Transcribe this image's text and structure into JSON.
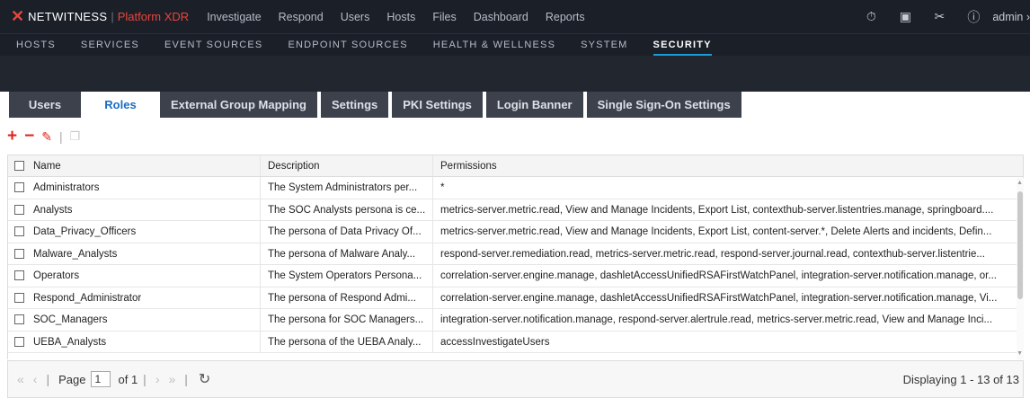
{
  "app": {
    "brand": "NETWITNESS",
    "product": "Platform XDR",
    "colors": {
      "brand_red": "#e8453c",
      "accent_blue": "#1b9bd7",
      "active_tab_text": "#1b6dc1"
    }
  },
  "topnav": {
    "items": [
      "Investigate",
      "Respond",
      "Users",
      "Hosts",
      "Files",
      "Dashboard",
      "Reports"
    ],
    "icons": [
      "timer-icon",
      "notepad-icon",
      "tools-icon",
      "help-icon"
    ],
    "user": "admin"
  },
  "subnav": {
    "items": [
      "HOSTS",
      "SERVICES",
      "EVENT SOURCES",
      "ENDPOINT SOURCES",
      "HEALTH & WELLNESS",
      "SYSTEM",
      "SECURITY"
    ],
    "active": "SECURITY"
  },
  "tabs": {
    "items": [
      "Users",
      "Roles",
      "External Group Mapping",
      "Settings",
      "PKI Settings",
      "Login Banner",
      "Single Sign-On Settings"
    ],
    "active": "Roles"
  },
  "toolbar": {
    "icons": [
      "add-icon",
      "remove-icon",
      "edit-icon",
      "copy-icon"
    ]
  },
  "grid": {
    "columns": [
      "Name",
      "Description",
      "Permissions"
    ],
    "rows": [
      {
        "name": "Administrators",
        "description": "The System Administrators per...",
        "permissions": "*"
      },
      {
        "name": "Analysts",
        "description": "The SOC Analysts persona is ce...",
        "permissions": "metrics-server.metric.read, View and Manage Incidents, Export List, contexthub-server.listentries.manage, springboard...."
      },
      {
        "name": "Data_Privacy_Officers",
        "description": "The persona of Data Privacy Of...",
        "permissions": "metrics-server.metric.read, View and Manage Incidents, Export List, content-server.*, Delete Alerts and incidents, Defin..."
      },
      {
        "name": "Malware_Analysts",
        "description": "The persona of Malware Analy...",
        "permissions": "respond-server.remediation.read, metrics-server.metric.read, respond-server.journal.read, contexthub-server.listentrie..."
      },
      {
        "name": "Operators",
        "description": "The System Operators Persona...",
        "permissions": "correlation-server.engine.manage, dashletAccessUnifiedRSAFirstWatchPanel, integration-server.notification.manage, or..."
      },
      {
        "name": "Respond_Administrator",
        "description": "The persona of Respond Admi...",
        "permissions": "correlation-server.engine.manage, dashletAccessUnifiedRSAFirstWatchPanel, integration-server.notification.manage, Vi..."
      },
      {
        "name": "SOC_Managers",
        "description": "The persona for SOC Managers...",
        "permissions": "integration-server.notification.manage, respond-server.alertrule.read, metrics-server.metric.read, View and Manage Inci..."
      },
      {
        "name": "UEBA_Analysts",
        "description": "The persona of the UEBA Analy...",
        "permissions": "accessInvestigateUsers"
      }
    ]
  },
  "pager": {
    "page_label": "Page",
    "page_value": "1",
    "of_label": "of 1",
    "display": "Displaying 1 - 13 of 13"
  }
}
